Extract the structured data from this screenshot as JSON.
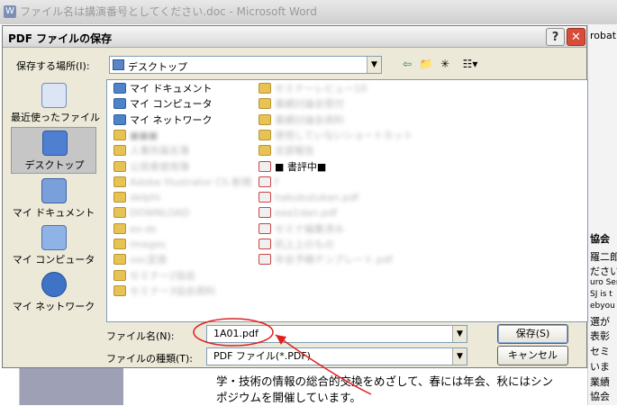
{
  "word": {
    "title": "ファイル名は講演番号としてください.doc - Microsoft Word",
    "right_fragments": [
      "robat",
      "協会",
      "羅二郎",
      "ださい",
      "uro Ser",
      "SJ is t",
      "ebyou",
      "選が",
      "表彰",
      "セミ",
      "いま",
      "業績",
      "協会"
    ],
    "body_line1": "学・技術の情報の総合的交換をめざして、春には年会、秋にはシン",
    "body_line2": "ポジウムを開催しています。"
  },
  "dialog": {
    "title": "PDF ファイルの保存",
    "help_label": "?",
    "close_label": "✕",
    "location_label": "保存する場所(I):",
    "location_value": "デスクトップ",
    "places": [
      {
        "label": "最近使ったファイル"
      },
      {
        "label": "デスクトップ"
      },
      {
        "label": "マイ ドキュメント"
      },
      {
        "label": "マイ コンピュータ"
      },
      {
        "label": "マイ ネットワーク"
      }
    ],
    "files_col1": [
      {
        "name": "マイ ドキュメント",
        "type": "sys"
      },
      {
        "name": "マイ コンピュータ",
        "type": "sys"
      },
      {
        "name": "マイ ネットワーク",
        "type": "sys"
      },
      {
        "name": "■■■",
        "type": "folder"
      },
      {
        "name": "人事所属名簿",
        "type": "folder"
      },
      {
        "name": "公用車使用簿",
        "type": "folder"
      },
      {
        "name": "Adobe Illustrator CS 新規",
        "type": "folder"
      },
      {
        "name": "delphi",
        "type": "folder"
      },
      {
        "name": "DOWNLOAD",
        "type": "folder"
      },
      {
        "name": "ex-ds",
        "type": "folder"
      },
      {
        "name": "images",
        "type": "folder"
      },
      {
        "name": "voc変換",
        "type": "folder"
      },
      {
        "name": "セミナー2協会",
        "type": "folder"
      },
      {
        "name": "セミナー3協会資料",
        "type": "folder"
      }
    ],
    "files_col2": [
      {
        "name": "セミナーレビュー10",
        "type": "folder"
      },
      {
        "name": "業績討論会受付",
        "type": "folder"
      },
      {
        "name": "業績討論会資料",
        "type": "folder"
      },
      {
        "name": "使用していないショートカット",
        "type": "folder"
      },
      {
        "name": "支部報告",
        "type": "folder"
      },
      {
        "name": "■ 書評中■",
        "type": "pdf"
      },
      {
        "name": "f",
        "type": "pdf"
      },
      {
        "name": "hakubutukan.pdf",
        "type": "pdf"
      },
      {
        "name": "eea1dan.pdf",
        "type": "pdf"
      },
      {
        "name": "セミナ編集済み",
        "type": "pdf"
      },
      {
        "name": "机上上のもの",
        "type": "pdf"
      },
      {
        "name": "年会予稿テンプレート.pdf",
        "type": "pdf"
      }
    ],
    "filename_label": "ファイル名(N):",
    "filename_value": "1A01.pdf",
    "filetype_label": "ファイルの種類(T):",
    "filetype_value": "PDF ファイル(*.PDF)",
    "save_label": "保存(S)",
    "cancel_label": "キャンセル"
  },
  "colors": {
    "annotation": "#e02020",
    "close_button": "#d64d3a"
  }
}
